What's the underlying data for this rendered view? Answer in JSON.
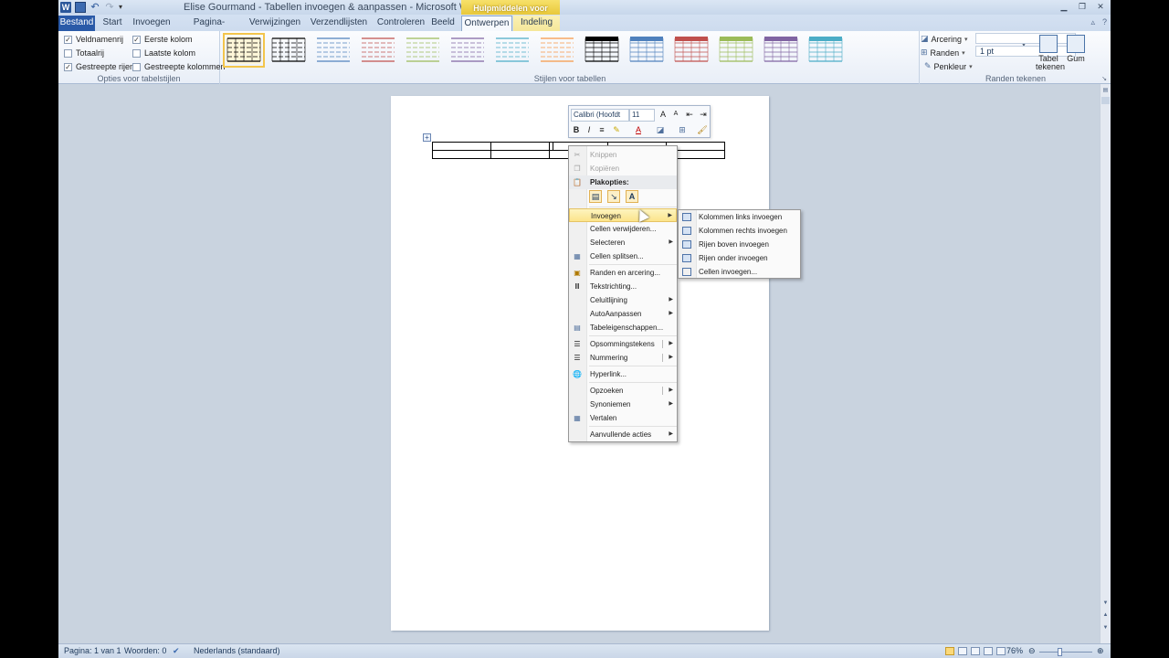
{
  "window": {
    "title": "Elise Gourmand - Tabellen invoegen & aanpassen - Microsoft Word",
    "context_tab_header": "Hulpmiddelen voor tabellen",
    "app_icon_letter": "W"
  },
  "tabs": [
    {
      "label": "Bestand"
    },
    {
      "label": "Start"
    },
    {
      "label": "Invoegen"
    },
    {
      "label": "Pagina-indeling"
    },
    {
      "label": "Verwijzingen"
    },
    {
      "label": "Verzendlijsten"
    },
    {
      "label": "Controleren"
    },
    {
      "label": "Beeld"
    },
    {
      "label": "Ontwerpen"
    },
    {
      "label": "Indeling"
    }
  ],
  "ribbon": {
    "table_style_options": {
      "label": "Opties voor tabelstijlen",
      "checkboxes": [
        {
          "label": "Veldnamenrij",
          "checked": true
        },
        {
          "label": "Totaalrij",
          "checked": false
        },
        {
          "label": "Gestreepte rijen",
          "checked": true
        },
        {
          "label": "Eerste kolom",
          "checked": true
        },
        {
          "label": "Laatste kolom",
          "checked": false
        },
        {
          "label": "Gestreepte kolommen",
          "checked": false
        }
      ]
    },
    "table_styles": {
      "label": "Stijlen voor tabellen",
      "swatch_colors": [
        "#000000",
        "#000000",
        "#4f81bd",
        "#c0504d",
        "#9bbb59",
        "#8064a2",
        "#4bacc6",
        "#f79646",
        "#000000",
        "#4f81bd",
        "#c0504d",
        "#9bbb59",
        "#8064a2",
        "#4bacc6"
      ]
    },
    "draw_borders": {
      "label": "Randen tekenen",
      "shading": "Arcering",
      "borders": "Randen",
      "line_weight": "1 pt",
      "pen_color": "Penkleur",
      "draw_table": "Tabel tekenen",
      "eraser": "Gum"
    }
  },
  "mini_toolbar": {
    "font": "Calibri (Hoofdt",
    "size": "11"
  },
  "context_menu": {
    "items": [
      {
        "label": "Knippen",
        "disabled": true
      },
      {
        "label": "Kopiëren",
        "disabled": true
      },
      {
        "label": "Plakopties:"
      },
      {
        "label": "Invoegen",
        "submenu": true
      },
      {
        "label": "Cellen verwijderen..."
      },
      {
        "label": "Selecteren",
        "submenu": true
      },
      {
        "label": "Cellen splitsen..."
      },
      {
        "label": "Randen en arcering..."
      },
      {
        "label": "Tekstrichting..."
      },
      {
        "label": "Celuitlijning",
        "submenu": true
      },
      {
        "label": "AutoAanpassen",
        "submenu": true
      },
      {
        "label": "Tabeleigenschappen..."
      },
      {
        "label": "Opsommingstekens",
        "submenu": true
      },
      {
        "label": "Nummering",
        "submenu": true
      },
      {
        "label": "Hyperlink..."
      },
      {
        "label": "Opzoeken",
        "submenu": true
      },
      {
        "label": "Synoniemen",
        "submenu": true
      },
      {
        "label": "Vertalen"
      },
      {
        "label": "Aanvullende acties",
        "submenu": true
      }
    ],
    "paste_options": [
      "bronopmaak",
      "samenvoegen",
      "A"
    ]
  },
  "submenu_insert": {
    "items": [
      {
        "label": "Kolommen links invoegen"
      },
      {
        "label": "Kolommen rechts invoegen"
      },
      {
        "label": "Rijen boven invoegen"
      },
      {
        "label": "Rijen onder invoegen"
      },
      {
        "label": "Cellen invoegen..."
      }
    ]
  },
  "statusbar": {
    "page": "Pagina: 1 van 1",
    "words": "Woorden: 0",
    "language": "Nederlands (standaard)",
    "zoom": "76%"
  }
}
